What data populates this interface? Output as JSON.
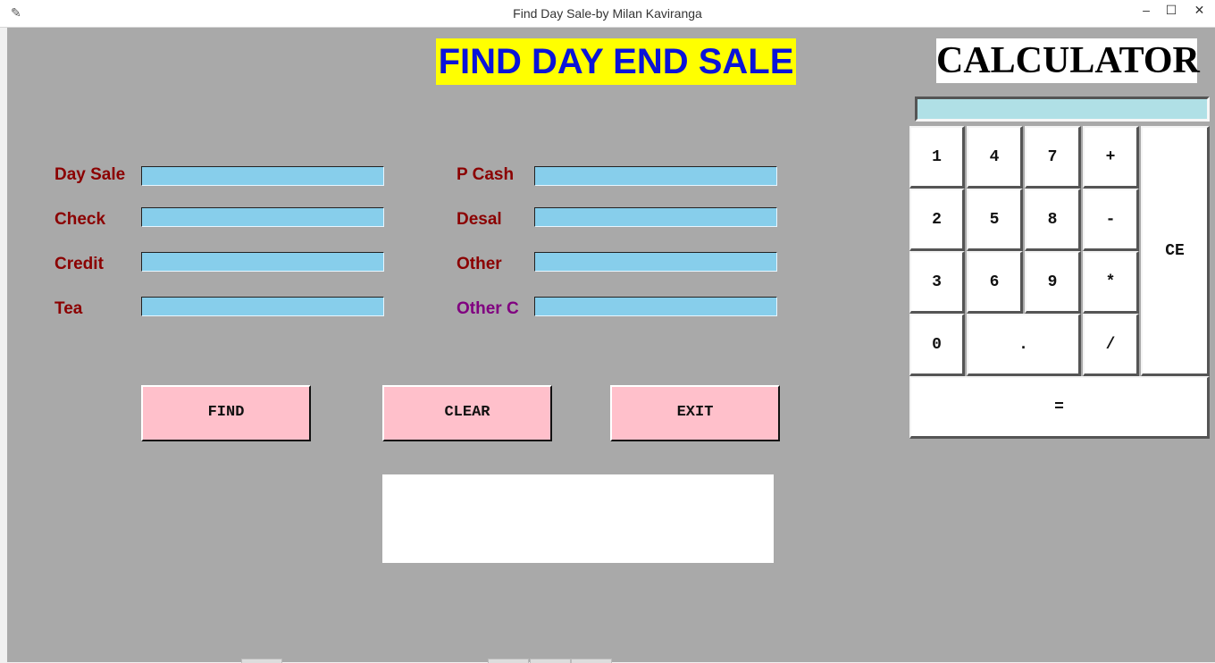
{
  "window": {
    "title": "Find Day Sale-by Milan Kaviranga",
    "app_icon": "feather-icon",
    "controls": {
      "minimize": "–",
      "maximize": "☐",
      "close": "✕"
    }
  },
  "main": {
    "title": "FIND DAY END SALE",
    "fields_left": [
      {
        "label": "Day Sale",
        "value": ""
      },
      {
        "label": "Check",
        "value": ""
      },
      {
        "label": "Credit",
        "value": ""
      },
      {
        "label": "Tea",
        "value": ""
      }
    ],
    "fields_right": [
      {
        "label": "P Cash",
        "value": ""
      },
      {
        "label": "Desal",
        "value": ""
      },
      {
        "label": "Other",
        "value": ""
      },
      {
        "label": "Other C",
        "value": ""
      }
    ],
    "buttons": {
      "find": "FIND",
      "clear": "CLEAR",
      "exit": "EXIT"
    },
    "result_text": ""
  },
  "calculator": {
    "title": "CALCULATOR",
    "display": "",
    "keys": {
      "k1": "1",
      "k4": "4",
      "k7": "7",
      "plus": "+",
      "k2": "2",
      "k5": "5",
      "k8": "8",
      "minus": "-",
      "k3": "3",
      "k6": "6",
      "k9": "9",
      "multiply": "*",
      "k0": "0",
      "dot": ".",
      "divide": "/",
      "ce": "CE",
      "equals": "="
    }
  },
  "colors": {
    "background": "#a9a9a9",
    "title_bg": "#ffff00",
    "title_fg": "#0a13d8",
    "label": "#8b0000",
    "label_alt": "#800080",
    "input_bg": "#87ceeb",
    "button_bg": "#ffc0cb",
    "calc_display_bg": "#b0e0e6"
  }
}
